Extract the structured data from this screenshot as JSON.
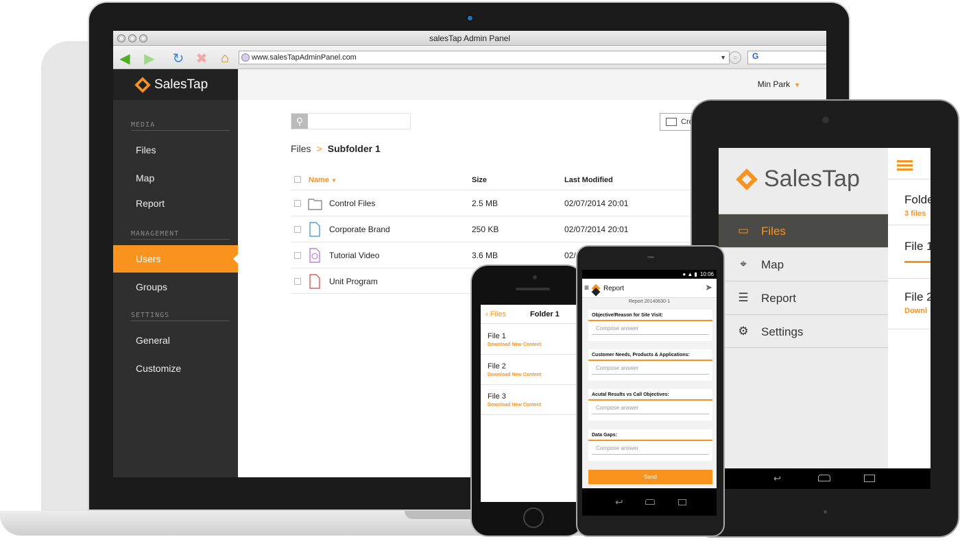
{
  "colors": {
    "accent": "#f7931e",
    "sidebar": "#2f2f2f",
    "sidebar_dark": "#222222"
  },
  "browser": {
    "title": "salesTap Admin Panel",
    "url": "www.salesTapAdminPanel.com",
    "search_engine_label": "G"
  },
  "admin": {
    "brand": "SalesTap",
    "user_name": "Min Park",
    "sections": [
      {
        "label": "MEDIA",
        "items": [
          "Files",
          "Map",
          "Report"
        ]
      },
      {
        "label": "MANAGEMENT",
        "items": [
          "Users",
          "Groups"
        ]
      },
      {
        "label": "SETTINGS",
        "items": [
          "General",
          "Customize"
        ]
      }
    ],
    "active_item": "Users",
    "create_label": "Cre",
    "breadcrumb": {
      "root": "Files",
      "separator": ">",
      "current": "Subfolder 1"
    },
    "columns": {
      "name": "Name",
      "size": "Size",
      "modified": "Last Modified"
    },
    "rows": [
      {
        "name": "Control Files",
        "size": "2.5 MB",
        "modified": "02/07/2014 20:01",
        "icon": "folder-icon"
      },
      {
        "name": "Corporate Brand",
        "size": "250 KB",
        "modified": "02/07/2014 20:01",
        "icon": "doc-file-icon"
      },
      {
        "name": "Tutorial Video",
        "size": "3.6 MB",
        "modified": "02/",
        "icon": "video-file-icon"
      },
      {
        "name": "Unit Program",
        "size": "",
        "modified": "",
        "icon": "pdf-file-icon"
      }
    ]
  },
  "tablet": {
    "brand": "SalesTap",
    "menu": [
      {
        "label": "Files",
        "icon": "folder-icon"
      },
      {
        "label": "Map",
        "icon": "map-pin-icon"
      },
      {
        "label": "Report",
        "icon": "report-icon"
      },
      {
        "label": "Settings",
        "icon": "gear-icon"
      }
    ],
    "active": "Files",
    "right_items": [
      {
        "title": "Folde",
        "sub": "3 files"
      },
      {
        "title": "File 1",
        "sub": ""
      },
      {
        "title": "File 2",
        "sub": "Downl"
      }
    ]
  },
  "iphone": {
    "back_label": "Files",
    "title": "Folder 1",
    "files": [
      {
        "name": "File 1",
        "action": "Download New Content"
      },
      {
        "name": "File 2",
        "action": "Download New Content"
      },
      {
        "name": "File 3",
        "action": "Download New Content"
      }
    ]
  },
  "android": {
    "time": "10:06",
    "title": "Report",
    "subtitle": "Report 20140630-1",
    "questions": [
      "Objective/Reason for Site Visit:",
      "Customer Needs, Products & Applications:",
      "Acutal Results vs Call Objectives:",
      "Data Gaps:"
    ],
    "answer_placeholder": "Compose answer",
    "send_label": "Send"
  }
}
